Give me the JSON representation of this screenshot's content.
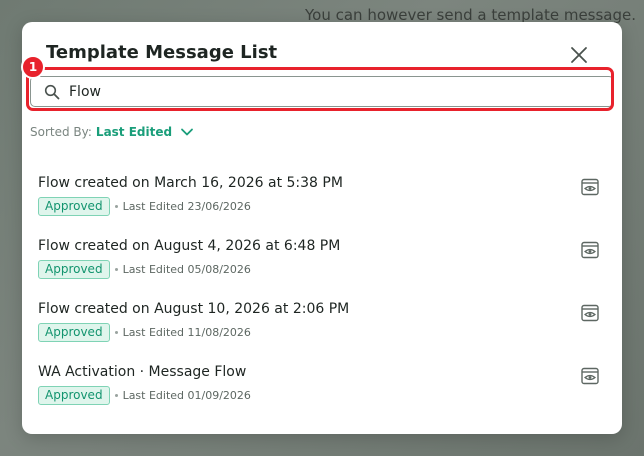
{
  "background": {
    "notice_text": "You can however send a template message."
  },
  "modal": {
    "title": "Template Message List",
    "close_icon": "close-icon"
  },
  "annotation": {
    "badge_number": "1",
    "color": "#e8222c"
  },
  "search": {
    "value": "Flow",
    "placeholder": "",
    "icon": "search-icon"
  },
  "sort": {
    "label": "Sorted By:",
    "value": "Last Edited",
    "icon": "chevron-down-icon"
  },
  "colors": {
    "accent": "#1a9e7a",
    "approved_bg": "#dff5ec",
    "approved_text": "#12946e"
  },
  "templates": [
    {
      "title": "Flow created on March 16, 2026 at 5:38 PM",
      "status": "Approved",
      "last_edited": "Last Edited 23/06/2026",
      "action_icon": "preview-icon"
    },
    {
      "title": "Flow created on August 4, 2026 at 6:48 PM",
      "status": "Approved",
      "last_edited": "Last Edited 05/08/2026",
      "action_icon": "preview-icon"
    },
    {
      "title": "Flow created on August 10, 2026 at 2:06 PM",
      "status": "Approved",
      "last_edited": "Last Edited 11/08/2026",
      "action_icon": "preview-icon"
    },
    {
      "title": "WA Activation · Message Flow",
      "status": "Approved",
      "last_edited": "Last Edited 01/09/2026",
      "action_icon": "preview-icon"
    }
  ]
}
